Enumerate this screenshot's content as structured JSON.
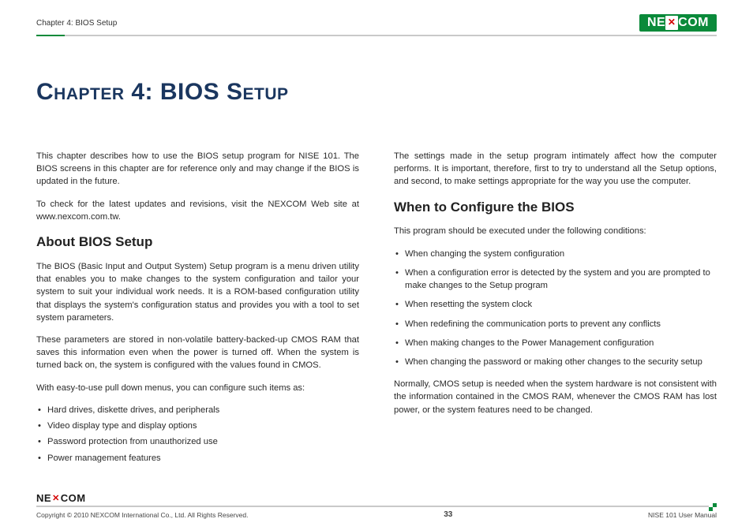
{
  "header": {
    "chapter_label": "Chapter 4: BIOS Setup",
    "logo_left": "NE",
    "logo_right": "COM"
  },
  "title": "Chapter 4: BIOS Setup",
  "left": {
    "intro1": "This chapter describes how to use the BIOS setup program for NISE 101. The BIOS screens in this chapter are for reference only and may change if the BIOS is updated in the future.",
    "intro2": "To check for the latest updates and revisions, visit the NEXCOM Web site at www.nexcom.com.tw.",
    "h_about": "About BIOS Setup",
    "about1": "The BIOS (Basic Input and Output System) Setup program is a menu driven utility that enables you to make changes to the system configuration and tailor your system to suit your individual work needs. It is a ROM-based configuration utility that displays the system's configuration status and provides you with a tool to set system parameters.",
    "about2": "These parameters are stored in non-volatile battery-backed-up CMOS RAM that saves this information even when the power is turned off. When the system is turned back on, the system is configured with the values found in CMOS.",
    "about3": "With easy-to-use pull down menus, you can configure such items as:",
    "items": [
      "Hard drives, diskette drives, and peripherals",
      "Video display type and display options",
      "Password protection from unauthorized use",
      "Power management features"
    ]
  },
  "right": {
    "intro1": "The settings made in the setup program intimately affect how the computer performs. It is important, therefore, first to try to understand all the Setup options, and second, to make settings appropriate for the way you use the computer.",
    "h_when": "When to Configure the BIOS",
    "when1": "This program should be executed under the following conditions:",
    "conds": [
      "When changing the system configuration",
      "When a configuration error is detected by the system and you are prompted to make changes to the Setup program",
      "When resetting the system clock",
      "When redefining the communication ports to prevent any conflicts",
      "When making changes to the Power Management configuration",
      "When changing the password or making other changes to the security setup"
    ],
    "when2": "Normally, CMOS setup is needed when the system hardware is not consistent with the information contained in the CMOS RAM, whenever the CMOS RAM has lost power, or the system features need to be changed."
  },
  "footer": {
    "logo_left": "NE",
    "logo_right": "COM",
    "copyright": "Copyright © 2010 NEXCOM International Co., Ltd. All Rights Reserved.",
    "page": "33",
    "doc": "NISE 101 User Manual"
  }
}
